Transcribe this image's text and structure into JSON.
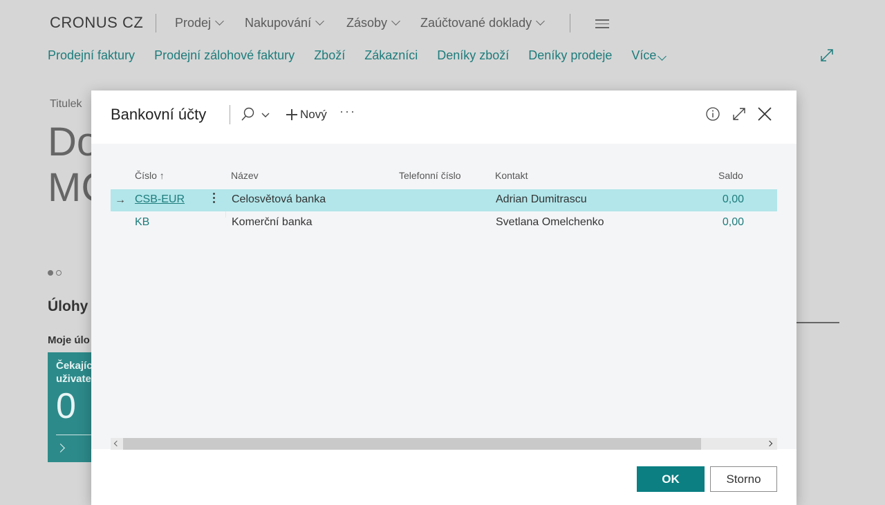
{
  "app": {
    "company": "CRONUS CZ",
    "top_nav": [
      "Prodej",
      "Nakupování",
      "Zásoby",
      "Zaúčtované doklady"
    ],
    "sub_nav": [
      "Prodejní faktury",
      "Prodejní zálohové faktury",
      "Zboží",
      "Zákazníci",
      "Deníky zboží",
      "Deníky prodeje",
      "Více"
    ],
    "headline_label": "Titulek",
    "headline_line1": "Do",
    "headline_line2": "MC",
    "activities_title": "Úlohy",
    "my_tasks": "Moje úlo",
    "tile_label_1": "Čekajíc",
    "tile_label_2": "uživate",
    "tile_value": "0"
  },
  "dialog": {
    "title": "Bankovní účty",
    "new_label": "Nový",
    "more_label": "···",
    "columns": {
      "number": "Číslo",
      "name": "Název",
      "phone": "Telefonní číslo",
      "contact": "Kontakt",
      "balance": "Saldo"
    },
    "rows": [
      {
        "number": "CSB-EUR",
        "name": "Celosvětová banka",
        "phone": "",
        "contact": "Adrian Dumitrascu",
        "balance": "0,00"
      },
      {
        "number": "KB",
        "name": "Komerční banka",
        "phone": "",
        "contact": "Svetlana Omelchenko",
        "balance": "0,00"
      }
    ],
    "ok_label": "OK",
    "cancel_label": "Storno"
  },
  "colors": {
    "accent": "#0b7f82",
    "link": "#1e7c7c",
    "selected_row": "#b2e6ea"
  }
}
